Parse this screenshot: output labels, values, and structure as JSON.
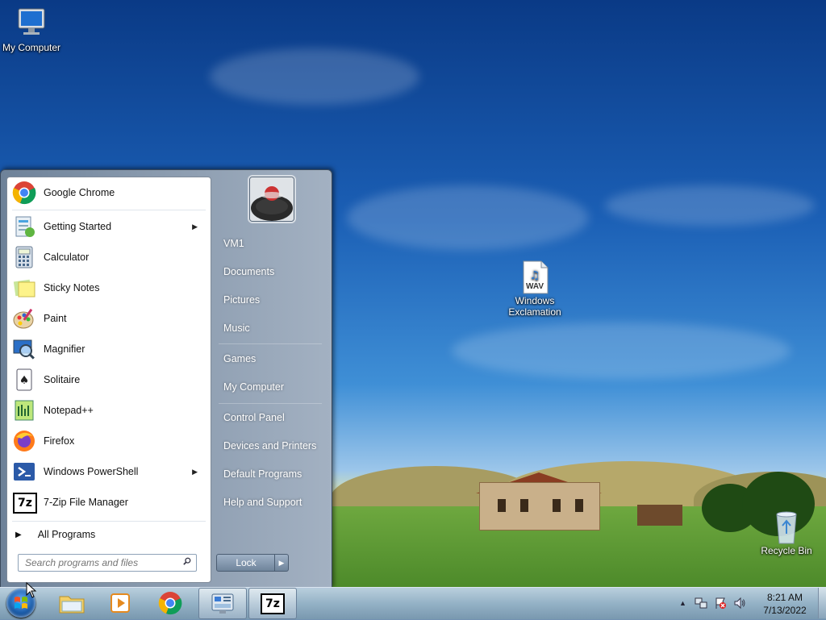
{
  "desktop": {
    "icons": [
      {
        "label": "My Computer",
        "icon": "computer-icon"
      },
      {
        "label": "Windows Exclamation",
        "icon": "wav-file-icon",
        "file_badge": "WAV"
      },
      {
        "label": "Recycle Bin",
        "icon": "recycle-bin-icon"
      }
    ]
  },
  "start_menu": {
    "programs": [
      {
        "label": "Google Chrome",
        "icon": "chrome-icon",
        "submenu": false
      },
      {
        "label": "Getting Started",
        "icon": "getting-started-icon",
        "submenu": true
      },
      {
        "label": "Calculator",
        "icon": "calculator-icon",
        "submenu": false
      },
      {
        "label": "Sticky Notes",
        "icon": "sticky-notes-icon",
        "submenu": false
      },
      {
        "label": "Paint",
        "icon": "paint-icon",
        "submenu": false
      },
      {
        "label": "Magnifier",
        "icon": "magnifier-icon",
        "submenu": false
      },
      {
        "label": "Solitaire",
        "icon": "solitaire-icon",
        "submenu": false
      },
      {
        "label": "Notepad++",
        "icon": "notepadpp-icon",
        "submenu": false
      },
      {
        "label": "Firefox",
        "icon": "firefox-icon",
        "submenu": false
      },
      {
        "label": "Windows PowerShell",
        "icon": "powershell-icon",
        "submenu": true
      },
      {
        "label": "7-Zip File Manager",
        "icon": "7zip-icon",
        "icon_text": "7z",
        "submenu": false
      }
    ],
    "all_programs": "All Programs",
    "search_placeholder": "Search programs and files",
    "right_items": [
      {
        "label": "VM1"
      },
      {
        "label": "Documents"
      },
      {
        "label": "Pictures"
      },
      {
        "label": "Music"
      },
      {
        "label": "Games"
      },
      {
        "label": "My Computer"
      },
      {
        "label": "Control Panel"
      },
      {
        "label": "Devices and Printers"
      },
      {
        "label": "Default Programs"
      },
      {
        "label": "Help and Support"
      }
    ],
    "lock_label": "Lock"
  },
  "taskbar": {
    "pinned": [
      {
        "name": "explorer",
        "icon": "folder-icon"
      },
      {
        "name": "media-player",
        "icon": "media-player-icon"
      },
      {
        "name": "chrome",
        "icon": "chrome-icon"
      },
      {
        "name": "control-panel",
        "icon": "control-panel-icon"
      },
      {
        "name": "7zip",
        "icon": "7zip-icon",
        "icon_text": "7z"
      }
    ],
    "clock_time": "8:21 AM",
    "clock_date": "7/13/2022"
  },
  "colors": {
    "sky_top": "#0a3a86",
    "start_menu_frame": "#8697ab",
    "taskbar": "#a8bdd3"
  }
}
